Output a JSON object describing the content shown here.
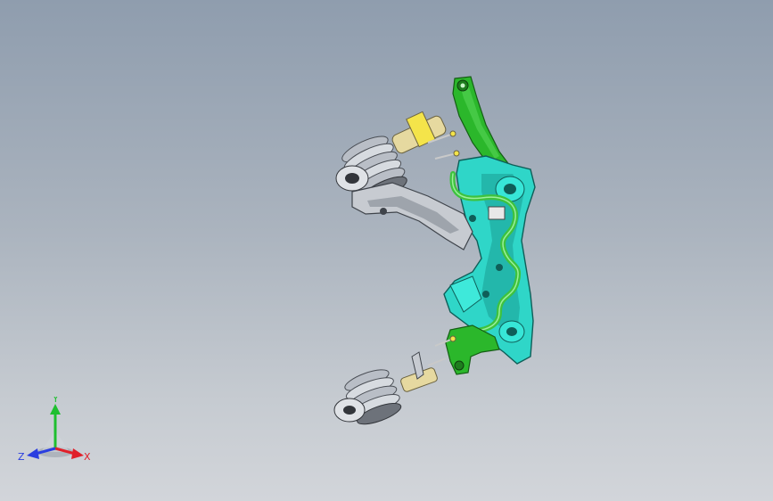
{
  "triad": {
    "y_label": "Y",
    "x_label": "X",
    "z_label": "Z",
    "colors": {
      "y": "#1fbf2f",
      "x": "#e0202a",
      "z": "#2a3ee0"
    }
  },
  "model": {
    "colors": {
      "subframe": "#2fd6c8",
      "subframe_dark": "#1a9e94",
      "control_arm": "#2bb72b",
      "stabilizer_bar": "#3ec23e",
      "strut_spring": "#b9bec6",
      "strut_spring_dark": "#6d727a",
      "strut_body": "#e6d9a0",
      "lower_arm": "#c7cbd1",
      "highlight_yellow": "#f4e44a"
    }
  }
}
